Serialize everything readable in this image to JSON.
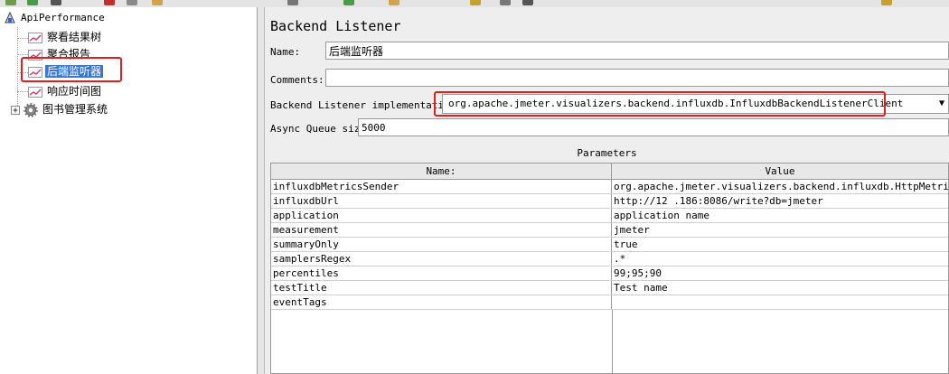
{
  "tree": {
    "root": "ApiPerformance",
    "items": [
      {
        "label": "察看结果树"
      },
      {
        "label": "聚合报告"
      },
      {
        "label": "后端监听器",
        "selected": true
      },
      {
        "label": "响应时间图"
      },
      {
        "label": "图书管理系统"
      }
    ]
  },
  "panel": {
    "title": "Backend Listener",
    "name_label": "Name:",
    "name_value": "后端监听器",
    "comments_label": "Comments:",
    "comments_value": "",
    "impl_label": "Backend Listener implementation",
    "impl_value": "org.apache.jmeter.visualizers.backend.influxdb.InfluxdbBackendListenerClient",
    "queue_label": "Async Queue size",
    "queue_value": "5000",
    "params_title": "Parameters",
    "table": {
      "headers": [
        "Name:",
        "Value"
      ],
      "rows": [
        [
          "influxdbMetricsSender",
          "org.apache.jmeter.visualizers.backend.influxdb.HttpMetricsS..."
        ],
        [
          "influxdbUrl",
          "http://12     .186:8086/write?db=jmeter"
        ],
        [
          "application",
          "application name"
        ],
        [
          "measurement",
          "jmeter"
        ],
        [
          "summaryOnly",
          "true"
        ],
        [
          "samplersRegex",
          ".*"
        ],
        [
          "percentiles",
          "99;95;90"
        ],
        [
          "testTitle",
          "Test name"
        ],
        [
          "eventTags",
          ""
        ]
      ]
    }
  },
  "colors": {
    "selection": "#3875d7",
    "highlight": "#e01e1e"
  }
}
